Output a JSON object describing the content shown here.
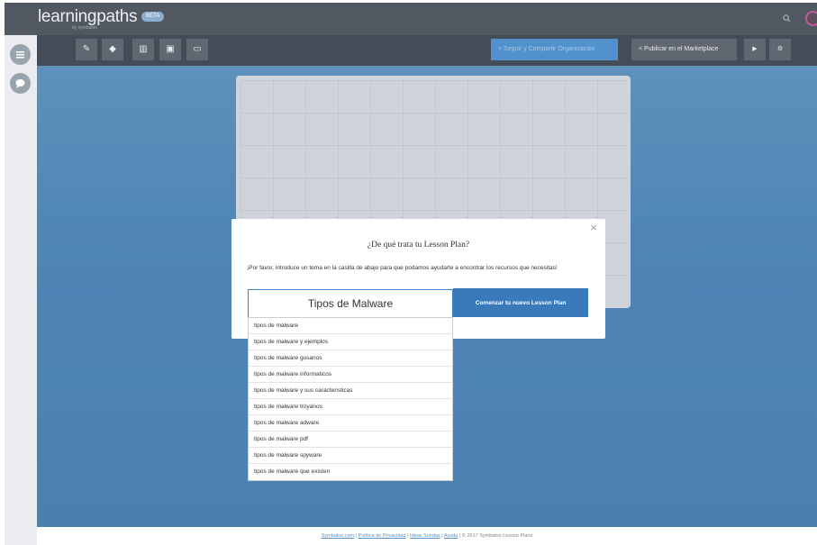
{
  "app": {
    "brand": "learningpaths",
    "brand_sub": "by symbaloo",
    "beta": "BETA"
  },
  "toolbar": {
    "tools": [
      {
        "icon": "pencil-icon",
        "glyph": "✎"
      },
      {
        "icon": "tag-icon",
        "glyph": "◆"
      },
      {
        "icon": "chart-icon",
        "glyph": "▥"
      },
      {
        "icon": "image-icon",
        "glyph": "▣"
      },
      {
        "icon": "screen-icon",
        "glyph": "▭"
      }
    ],
    "join_label": "+ Seguir y Compartir Organización",
    "publish_label": "< Publicar en el Marketplace",
    "play_glyph": "▶",
    "settings_glyph": "⚙"
  },
  "modal": {
    "close_glyph": "×",
    "title": "¿De qué trata tu Lesson Plan?",
    "text": "¡Por favor, introduce un tema en la casilla de abajo para que podamos ayudarte a encontrar los recursos que necesitas!",
    "input_value": "Tipos de Malware",
    "start_label": "Comenzar tu nuevo Lesson Plan",
    "suggestions": [
      "tipos de malware",
      "tipos de malware y ejemplos",
      "tipos de malware gusanos",
      "tipos de malware informaticos",
      "tipos de malware y sus caracteristicas",
      "tipos de malware troyanos",
      "tipos de malware adware",
      "tipos de malware pdf",
      "tipos de malware spyware",
      "tipos de malware que existen"
    ]
  },
  "footer": {
    "links": [
      "Symbaloo.com",
      "Política de Privacidad",
      "Ideas Sondas",
      "Ayuda"
    ],
    "copyright": "© 2017 Symbaloo Lesson Plans"
  },
  "colors": {
    "accent": "#3a79ba",
    "topbar": "#3f4650",
    "canvas": "#3b79ae"
  }
}
